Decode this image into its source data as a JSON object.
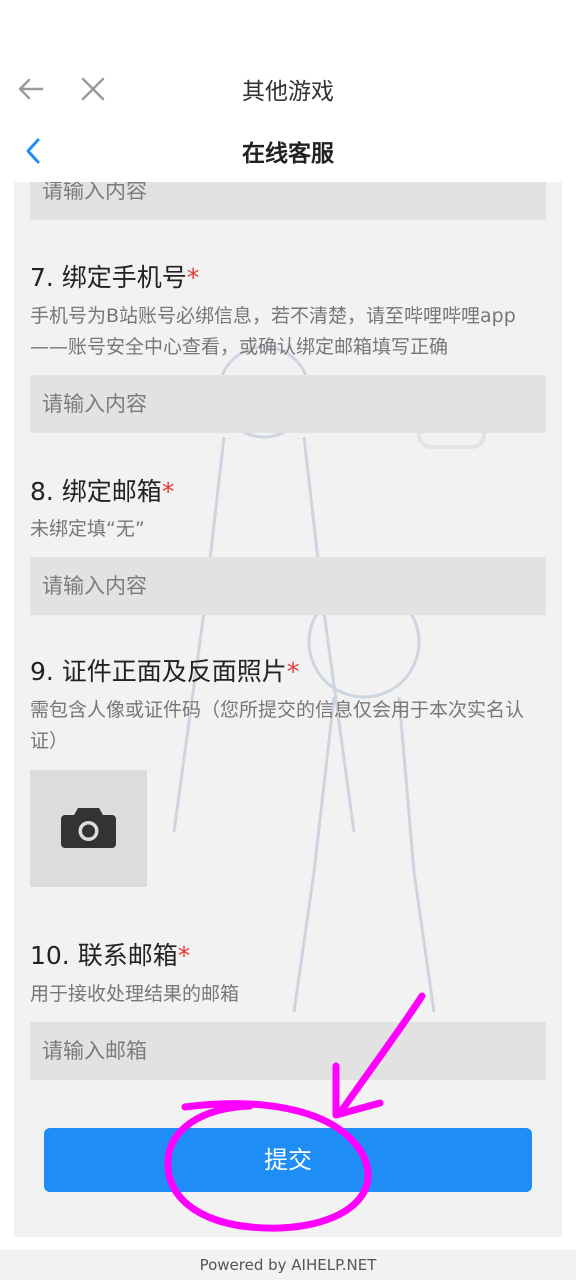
{
  "topbar": {
    "title": "其他游戏"
  },
  "header": {
    "title": "在线客服"
  },
  "form": {
    "prev_input_placeholder": "请输入内容",
    "q7": {
      "title": "7. 绑定手机号",
      "required": "*",
      "desc": "手机号为B站账号必绑信息，若不清楚，请至哔哩哔哩app——账号安全中心查看，或确认绑定邮箱填写正确",
      "placeholder": "请输入内容"
    },
    "q8": {
      "title": "8. 绑定邮箱",
      "required": "*",
      "desc": "未绑定填“无”",
      "placeholder": "请输入内容"
    },
    "q9": {
      "title": "9. 证件正面及反面照片",
      "required": "*",
      "desc": "需包含人像或证件码（您所提交的信息仅会用于本次实名认证）"
    },
    "q10": {
      "title": "10. 联系邮箱",
      "required": "*",
      "desc": "用于接收处理结果的邮箱",
      "placeholder": "请输入邮箱"
    },
    "submit_label": "提交"
  },
  "footer": {
    "text": "Powered by AIHELP.NET"
  },
  "colors": {
    "accent": "#1e8ef6",
    "required": "#e53935",
    "annotation": "#ff00ff"
  },
  "icons": [
    "back-arrow-icon",
    "close-icon",
    "chevron-left-icon",
    "camera-icon"
  ]
}
